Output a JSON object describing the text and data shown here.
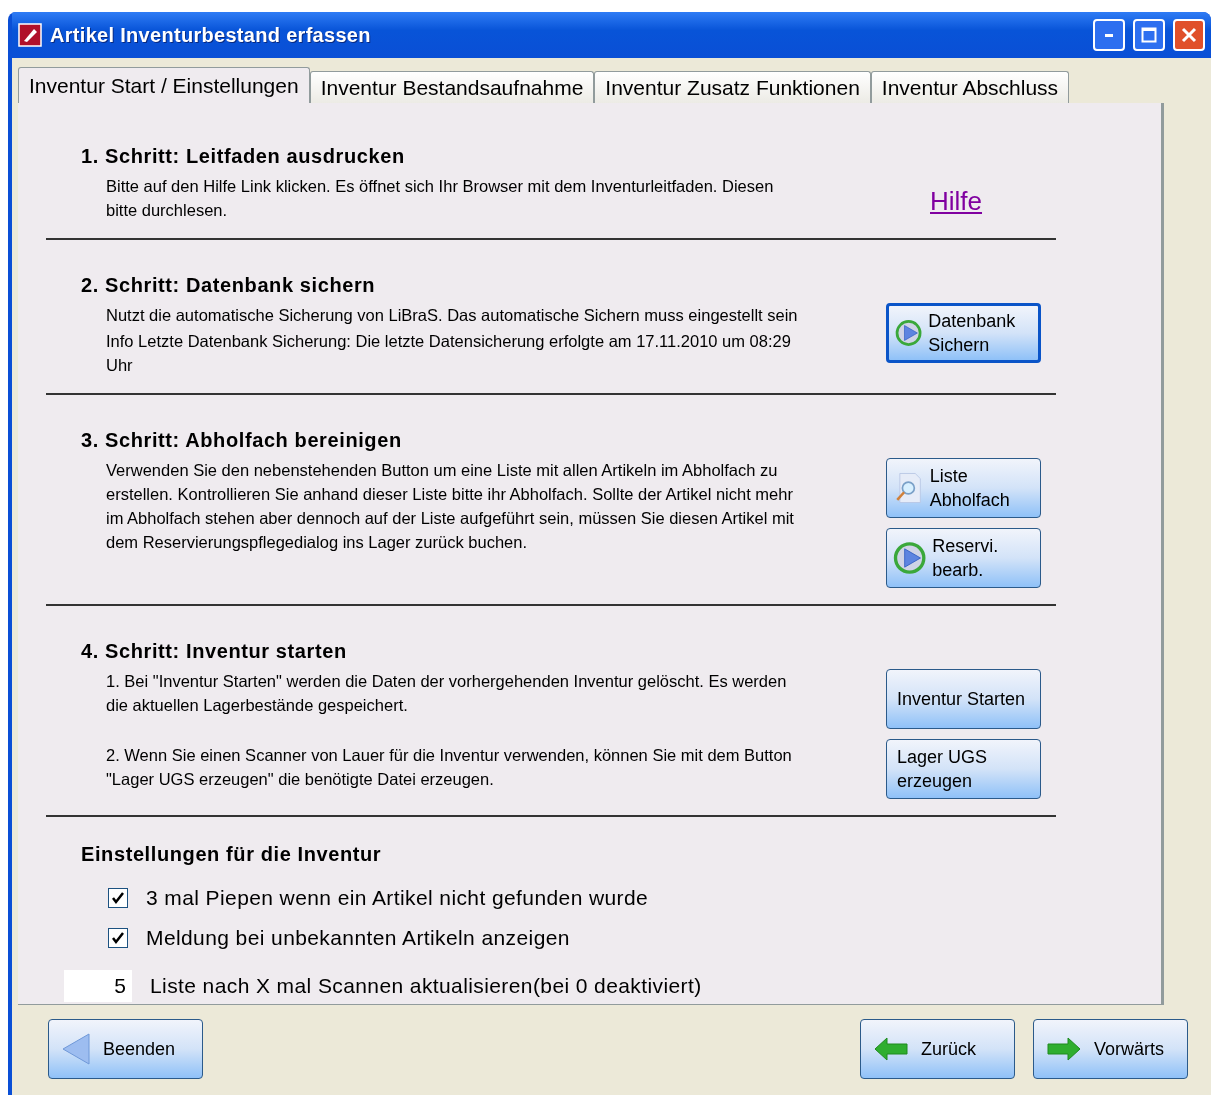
{
  "window": {
    "title": "Artikel Inventurbestand erfassen"
  },
  "tabs": [
    {
      "label": "Inventur Start / Einstellungen",
      "selected": true
    },
    {
      "label": "Inventur Bestandsaufnahme",
      "selected": false
    },
    {
      "label": "Inventur Zusatz Funktionen",
      "selected": false
    },
    {
      "label": "Inventur Abschluss",
      "selected": false
    }
  ],
  "steps": [
    {
      "title": "1. Schritt: Leitfaden ausdrucken",
      "paragraphs": [
        "Bitte auf den Hilfe Link klicken. Es öffnet sich Ihr Browser mit dem Inventurleitfaden. Diesen bitte durchlesen."
      ],
      "link": {
        "label": "Hilfe",
        "visited": true
      }
    },
    {
      "title": "2. Schritt: Datenbank sichern",
      "paragraphs": [
        "Nutzt die automatische Sicherung von LiBraS. Das automatische Sichern muss eingestellt sein",
        "Info Letzte Datenbank Sicherung: Die letzte Datensicherung erfolgte am 17.11.2010 um 08:29 Uhr"
      ],
      "buttons": [
        {
          "label": "Datenbank Sichern",
          "focused": true
        }
      ]
    },
    {
      "title": "3. Schritt: Abholfach bereinigen",
      "paragraphs": [
        "Verwenden Sie den nebenstehenden Button um eine Liste mit allen Artikeln im Abholfach zu erstellen. Kontrollieren Sie anhand dieser Liste bitte ihr Abholfach. Sollte der Artikel nicht mehr im Abholfach stehen aber dennoch  auf der Liste aufgeführt sein, müssen Sie diesen Artikel mit dem Reservierungspflegedialog ins Lager zurück buchen."
      ],
      "buttons": [
        {
          "label": "Liste Abholfach",
          "focused": false
        },
        {
          "label": "Reservi. bearb.",
          "focused": false
        }
      ]
    },
    {
      "title": "4. Schritt: Inventur starten",
      "paragraphs": [
        "1. Bei \"Inventur Starten\" werden die Daten der vorhergehenden Inventur gelöscht. Es werden die aktuellen Lagerbestände gespeichert.",
        "2. Wenn Sie einen Scanner von  Lauer für die Inventur verwenden, können Sie mit dem Button \"Lager UGS erzeugen\" die benötigte Datei erzeugen."
      ],
      "buttons": [
        {
          "label": "Inventur Starten",
          "focused": false
        },
        {
          "label": "Lager UGS erzeugen",
          "focused": false
        }
      ]
    }
  ],
  "settings": {
    "title": "Einstellungen für die Inventur",
    "checkboxes": [
      {
        "label": "3 mal Piepen wenn ein Artikel nicht gefunden wurde",
        "checked": true
      },
      {
        "label": "Meldung bei unbekannten Artikeln anzeigen",
        "checked": true
      }
    ],
    "scan_interval": {
      "value": "5",
      "label": "Liste nach X mal Scannen aktualisieren(bei 0 deaktiviert)"
    }
  },
  "footer": {
    "buttons": [
      {
        "label": "Beenden"
      },
      {
        "label": "Zurück"
      },
      {
        "label": "Vorwärts"
      }
    ]
  }
}
